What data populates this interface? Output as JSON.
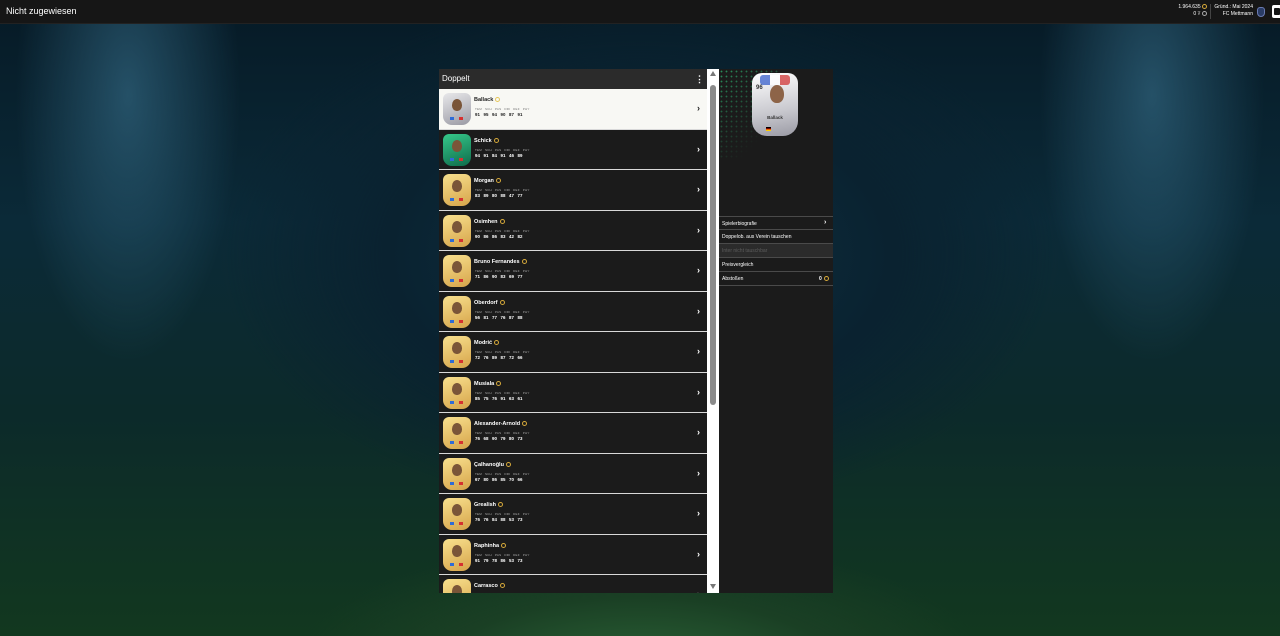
{
  "topbar": {
    "title": "Nicht zugewiesen",
    "coins": "1.964.635",
    "points": "0",
    "founded": "Gründ.: Mai 2024",
    "club_name": "FC Mettmann"
  },
  "list": {
    "title": "Doppelt",
    "stat_labels": "TEM SCH PAS DRI DEF PHY",
    "players": [
      {
        "name": "Ballack",
        "stats": "91 95 94 90 87 91",
        "selected": true
      },
      {
        "name": "Schick",
        "stats": "94 91 84 91 46 89",
        "selected": false
      },
      {
        "name": "Morgan",
        "stats": "83 89 80 88 47 77",
        "selected": false
      },
      {
        "name": "Osimhen",
        "stats": "90 86 86 83 42 82",
        "selected": false
      },
      {
        "name": "Bruno Fernandes",
        "stats": "71 86 90 83 69 77",
        "selected": false
      },
      {
        "name": "Oberdorf",
        "stats": "56 81 77 76 87 88",
        "selected": false
      },
      {
        "name": "Modrić",
        "stats": "72 76 89 87 72 66",
        "selected": false
      },
      {
        "name": "Musiala",
        "stats": "85 75 76 91 63 61",
        "selected": false
      },
      {
        "name": "Alexander-Arnold",
        "stats": "76 68 90 79 80 73",
        "selected": false
      },
      {
        "name": "Çalhanoğlu",
        "stats": "67 80 86 85 70 66",
        "selected": false
      },
      {
        "name": "Grealish",
        "stats": "76 76 84 88 53 73",
        "selected": false
      },
      {
        "name": "Raphinha",
        "stats": "91 79 78 86 53 73",
        "selected": false
      },
      {
        "name": "Carrasco",
        "stats": "",
        "selected": false
      }
    ]
  },
  "detail": {
    "card_name": "Ballack",
    "card_rating": "96",
    "menu": [
      {
        "label": "Spielerbiografie"
      },
      {
        "label": "Doppelob. aus Verein tauschen"
      },
      {
        "label": "Inter nicht tauschbar"
      },
      {
        "label": "Preisvergleich"
      },
      {
        "label": "Abstoßen",
        "value": "0"
      }
    ]
  }
}
